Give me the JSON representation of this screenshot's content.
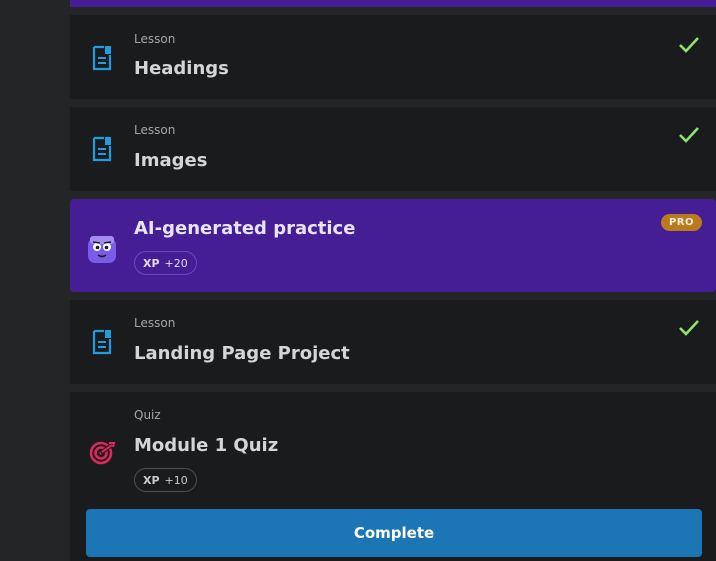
{
  "colors": {
    "background": "#232527",
    "card": "#1a1b1d",
    "pro_card": "#451e96",
    "check": "#8fe36b",
    "lesson_icon": "#1f9de0",
    "quiz_icon": "#e0265a",
    "pro_badge": "#b97b1e",
    "complete_button": "#1c76b5"
  },
  "items": [
    {
      "type": "Lesson",
      "title": "Headings",
      "icon": "document-icon",
      "status": "completed"
    },
    {
      "type": "Lesson",
      "title": "Images",
      "icon": "document-icon",
      "status": "completed"
    },
    {
      "title": "AI-generated practice",
      "icon": "ai-mascot-icon",
      "badge": "PRO",
      "xp_label": "XP",
      "xp_value": "+20"
    },
    {
      "type": "Lesson",
      "title": "Landing Page Project",
      "icon": "document-icon",
      "status": "completed"
    },
    {
      "type": "Quiz",
      "title": "Module 1 Quiz",
      "icon": "target-icon",
      "xp_label": "XP",
      "xp_value": "+10"
    }
  ],
  "footer": {
    "complete_label": "Complete"
  }
}
